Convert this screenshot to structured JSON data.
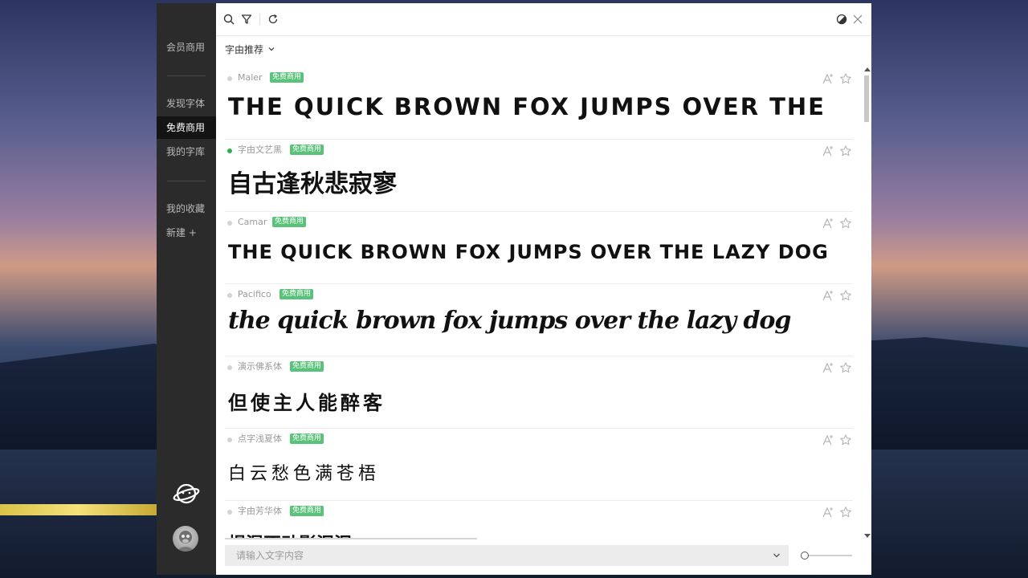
{
  "sidebar": {
    "items": [
      {
        "label": "会员商用"
      },
      {
        "label": "发现字体"
      },
      {
        "label": "免费商用"
      },
      {
        "label": "我的字库"
      },
      {
        "label": "我的收藏"
      },
      {
        "label": "新建 +"
      }
    ],
    "active": "免费商用"
  },
  "toolbar": {
    "icons": [
      "search-icon",
      "filter-icon",
      "refresh-icon",
      "theme-icon",
      "close-icon"
    ]
  },
  "filter": {
    "label": "字由推荐"
  },
  "fonts": [
    {
      "name": "Maler",
      "badge": "免费商用",
      "sample": "THE QUICK BROWN FOX JUMPS OVER THE LAZY DOG",
      "status": "none"
    },
    {
      "name": "字由文艺黑",
      "badge": "免费商用",
      "sample": "自古逢秋悲寂寥",
      "status": "installed"
    },
    {
      "name": "Camar",
      "badge": "免费商用",
      "sample": "THE QUICK BROWN FOX JUMPS OVER THE LAZY DOG",
      "status": "none"
    },
    {
      "name": "Pacifico",
      "badge": "免费商用",
      "sample": "the quick brown fox jumps over the lazy dog",
      "status": "none"
    },
    {
      "name": "演示佛系体",
      "badge": "免费商用",
      "sample": "但使主人能醉客",
      "status": "none"
    },
    {
      "name": "点字浅夏体",
      "badge": "免费商用",
      "sample": "白云愁色满苍梧",
      "status": "none"
    },
    {
      "name": "字由芳华体",
      "badge": "免费商用",
      "sample": "榻湿不动影泥泥",
      "status": "none"
    }
  ],
  "input": {
    "placeholder": "请输入文字内容",
    "value": ""
  },
  "size_slider": {
    "value": 0
  },
  "colors": {
    "accent": "#5bc27b",
    "installed": "#2bb24c",
    "sidebar": "#2b2b2b"
  }
}
